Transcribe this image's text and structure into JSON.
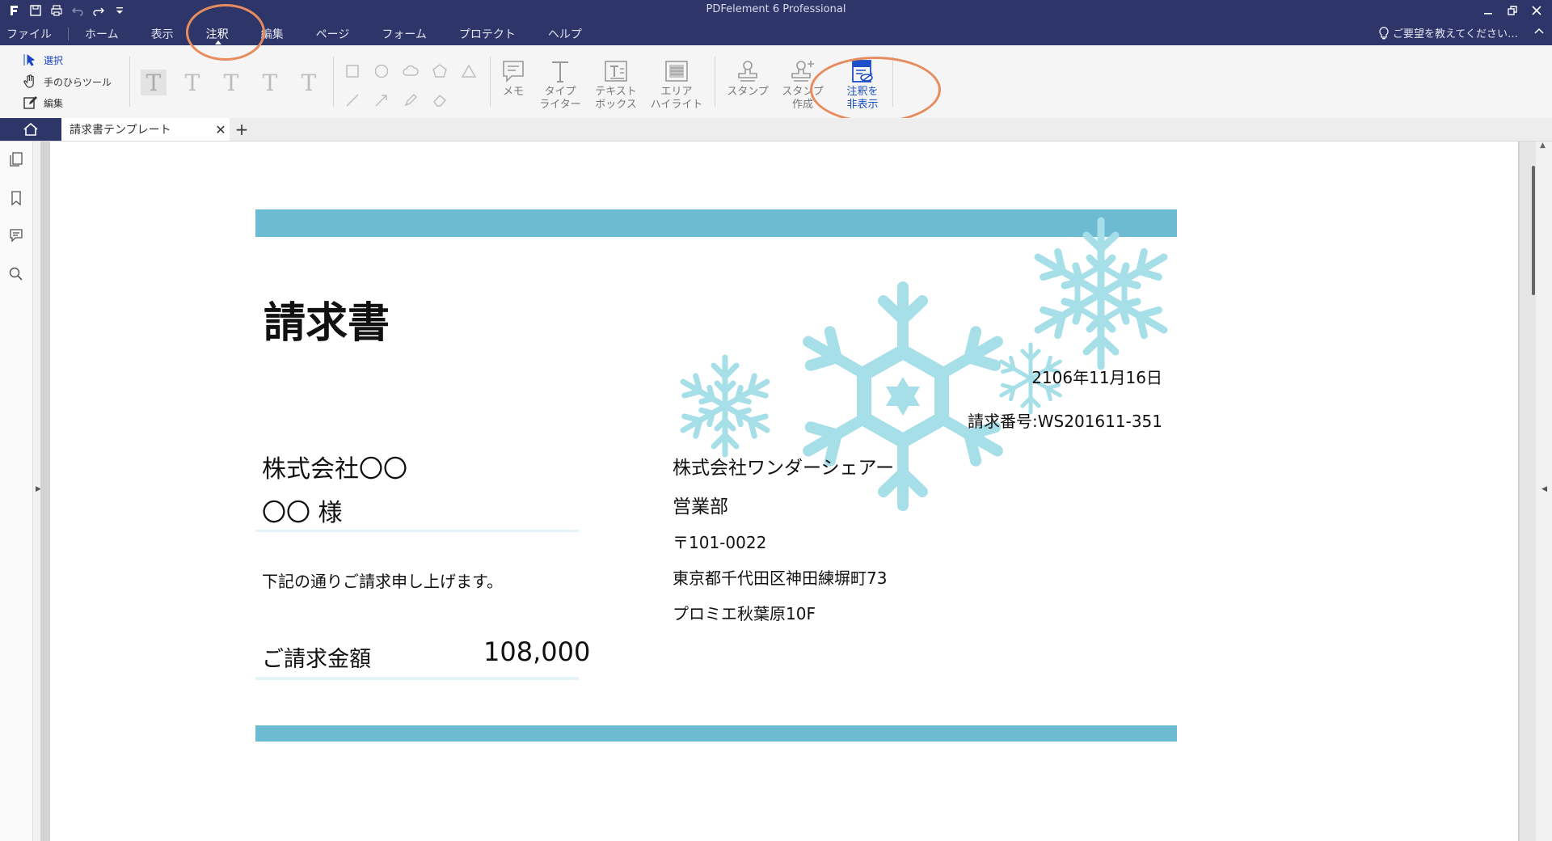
{
  "app": {
    "title": "PDFelement 6 Professional",
    "feedback_text": "ご要望を教えてください…",
    "accent_color": "#2e3568",
    "highlight_color": "#e78c5f"
  },
  "menu": {
    "items": [
      "ファイル",
      "ホーム",
      "表示",
      "注釈",
      "編集",
      "ページ",
      "フォーム",
      "プロテクト",
      "ヘルプ"
    ],
    "active": "注釈"
  },
  "ribbon": {
    "select": "選択",
    "hand": "手のひらツール",
    "edit": "編集",
    "memo": "メモ",
    "typewriter": [
      "タイプ",
      "ライター"
    ],
    "textbox": [
      "テキスト",
      "ボックス"
    ],
    "area_highlight": [
      "エリア",
      "ハイライト"
    ],
    "stamp": "スタンプ",
    "create_stamp": [
      "スタンプ",
      "作成"
    ],
    "hide_annotations": [
      "注釈を",
      "非表示"
    ]
  },
  "tabs": {
    "document": "請求書テンプレート"
  },
  "invoice": {
    "heading": "請求書",
    "date": "2106年11月16日",
    "invoice_no": "請求番号:WS201611-351",
    "client_company": "株式会社〇〇",
    "client_name": "〇〇 様",
    "greeting": "下記の通りご請求申し上げます。",
    "amount_label": "ご請求金額",
    "amount_value": "108,000",
    "sender_company": "株式会社ワンダーシェアー",
    "sender_dept": "営業部",
    "sender_postal": "〒101-0022",
    "sender_address": "東京都千代田区神田練塀町73",
    "sender_building": "プロミエ秋葉原10F",
    "band_color": "#6dbad3",
    "snowflake_color": "#a6dfe8"
  }
}
